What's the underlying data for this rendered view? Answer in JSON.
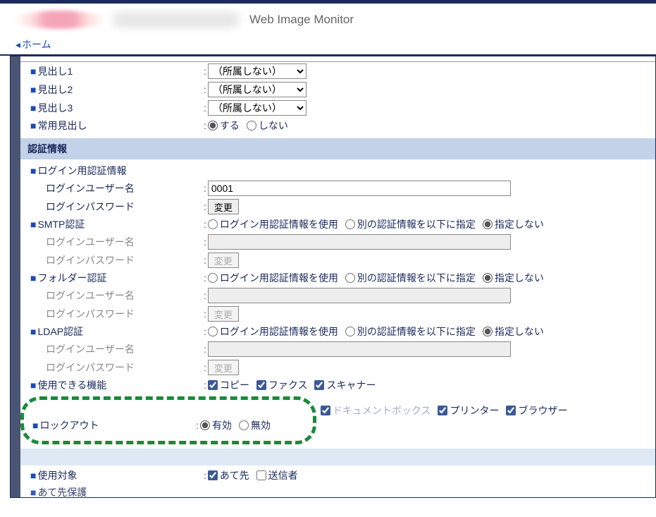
{
  "header": {
    "app_title": "Web Image Monitor",
    "home_link": "ホーム"
  },
  "headings": {
    "h1_label": "見出し1",
    "h2_label": "見出し2",
    "h3_label": "見出し3",
    "common_label": "常用見出し",
    "select_none": "（所属しない）",
    "opt_yes": "する",
    "opt_no": "しない"
  },
  "section_auth": "認証情報",
  "login_auth": {
    "label": "ログイン用認証情報",
    "user_label": "ログインユーザー名",
    "user_value": "0001",
    "pass_label": "ログインパスワード",
    "change_btn": "変更"
  },
  "smtp": {
    "label": "SMTP認証",
    "user_label": "ログインユーザー名",
    "pass_label": "ログインパスワード",
    "change_btn": "変更"
  },
  "folder": {
    "label": "フォルダー認証",
    "user_label": "ログインユーザー名",
    "pass_label": "ログインパスワード",
    "change_btn": "変更"
  },
  "ldap": {
    "label": "LDAP認証",
    "user_label": "ログインユーザー名",
    "pass_label": "ログインパスワード",
    "change_btn": "変更"
  },
  "auth_radio": {
    "use_login": "ログイン用認証情報を使用",
    "specify_other": "別の認証情報を以下に指定",
    "dont_specify": "指定しない"
  },
  "functions": {
    "label": "使用できる機能",
    "copy": "コピー",
    "fax": "ファクス",
    "scanner": "スキャナー",
    "docserver": "ドキュメントボックス",
    "printer": "プリンター",
    "browser": "ブラウザー"
  },
  "lockout": {
    "label": "ロックアウト",
    "enabled": "有効",
    "disabled": "無効"
  },
  "usage": {
    "label": "使用対象",
    "dest": "あて先",
    "sender": "送信者"
  },
  "protect": {
    "label": "あて先保護"
  }
}
